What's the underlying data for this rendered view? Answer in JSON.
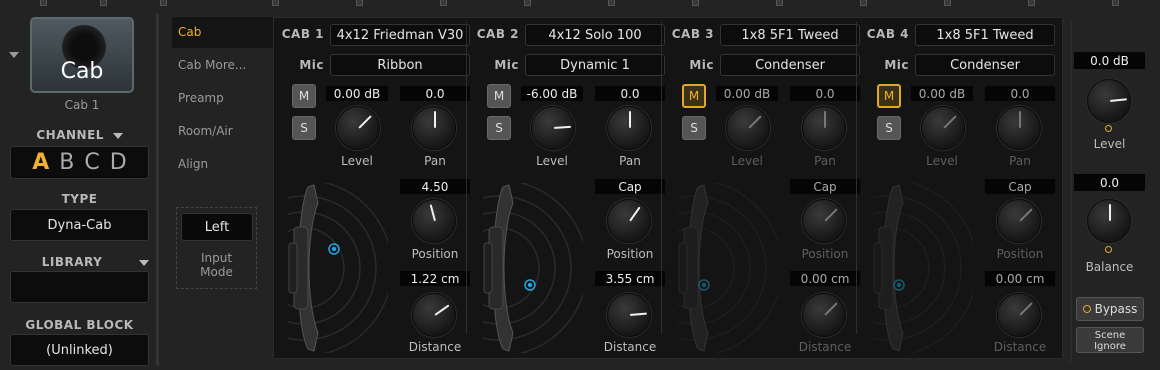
{
  "block": {
    "icon_label": "Cab",
    "name": "Cab 1"
  },
  "left": {
    "channel_label": "CHANNEL",
    "channels": [
      "A",
      "B",
      "C",
      "D"
    ],
    "type_label": "TYPE",
    "type_value": "Dyna-Cab",
    "library_label": "LIBRARY",
    "library_value": "",
    "global_label": "GLOBAL BLOCK",
    "global_value": "(Unlinked)"
  },
  "tabs": [
    "Cab",
    "Cab More...",
    "Preamp",
    "Room/Air",
    "Align"
  ],
  "input_mode": {
    "value": "Left",
    "label1": "Input",
    "label2": "Mode"
  },
  "cabs": [
    {
      "label": "CAB 1",
      "model": "4x12 Friedman V30",
      "mic": "Ribbon",
      "mic_label": "Mic",
      "m": "M",
      "s": "S",
      "level": "0.00 dB",
      "pan": "0.0",
      "level_label": "Level",
      "pan_label": "Pan",
      "position": "4.50",
      "position_label": "Position",
      "distance": "1.22 cm",
      "distance_label": "Distance"
    },
    {
      "label": "CAB 2",
      "model": "4x12 Solo 100",
      "mic": "Dynamic 1",
      "mic_label": "Mic",
      "m": "M",
      "s": "S",
      "level": "-6.00 dB",
      "pan": "0.0",
      "level_label": "Level",
      "pan_label": "Pan",
      "position": "Cap",
      "position_label": "Position",
      "distance": "3.55 cm",
      "distance_label": "Distance"
    },
    {
      "label": "CAB 3",
      "model": "1x8 5F1 Tweed",
      "mic": "Condenser",
      "mic_label": "Mic",
      "m": "M",
      "s": "S",
      "level": "0.00 dB",
      "pan": "0.0",
      "level_label": "Level",
      "pan_label": "Pan",
      "position": "Cap",
      "position_label": "Position",
      "distance": "0.00 cm",
      "distance_label": "Distance"
    },
    {
      "label": "CAB 4",
      "model": "1x8 5F1 Tweed",
      "mic": "Condenser",
      "mic_label": "Mic",
      "m": "M",
      "s": "S",
      "level": "0.00 dB",
      "pan": "0.0",
      "level_label": "Level",
      "pan_label": "Pan",
      "position": "Cap",
      "position_label": "Position",
      "distance": "0.00 cm",
      "distance_label": "Distance"
    }
  ],
  "right": {
    "level": "0.0 dB",
    "level_label": "Level",
    "balance": "0.0",
    "balance_label": "Balance",
    "bypass": "Bypass",
    "scene1": "Scene",
    "scene2": "Ignore"
  },
  "colors": {
    "accent": "#e2a82a",
    "mic_dot": "#1fa8e0"
  }
}
